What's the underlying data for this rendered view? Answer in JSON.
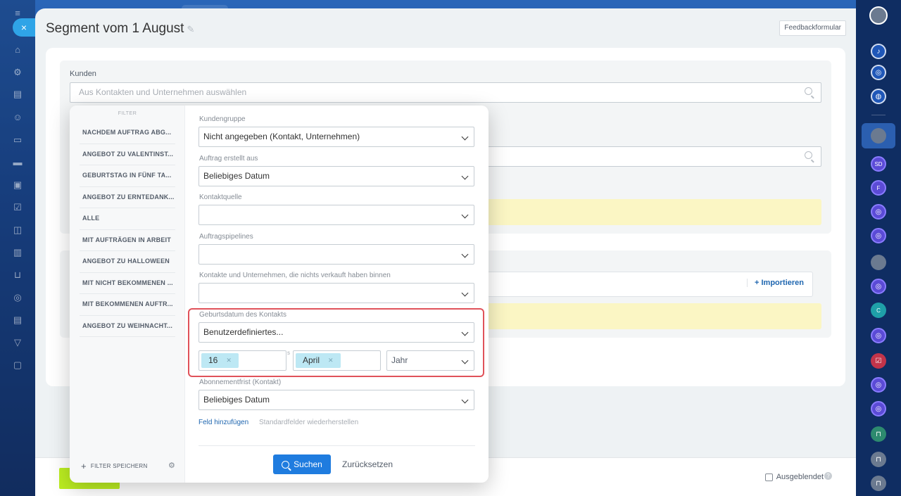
{
  "window": {
    "title": "Segment vom 1 August",
    "feedback_label": "Feedbackformular"
  },
  "main": {
    "customers_label": "Kunden",
    "customers_placeholder": "Aus Kontakten und Unternehmen auswählen",
    "import_label": "+ Importieren"
  },
  "filter": {
    "heading": "FILTER",
    "items": [
      "NACHDEM AUFTRAG ABG...",
      "ANGEBOT ZU VALENTINST...",
      "GEBURTSTAG IN FÜNF TA...",
      "ANGEBOT ZU ERNTEDANK...",
      "ALLE",
      "MIT AUFTRÄGEN IN ARBEIT",
      "ANGEBOT ZU HALLOWEEN",
      "MIT NICHT BEKOMMENEN ...",
      "MIT BEKOMMENEN AUFTR...",
      "ANGEBOT ZU WEIHNACHT..."
    ],
    "save_label": "FILTER SPEICHERN"
  },
  "fields": {
    "group_label": "Kundengruppe",
    "group_value": "Nicht angegeben (Kontakt, Unternehmen)",
    "order_label": "Auftrag erstellt aus",
    "order_value": "Beliebiges Datum",
    "source_label": "Kontaktquelle",
    "source_value": "",
    "pipelines_label": "Auftragspipelines",
    "pipelines_value": "",
    "nosale_label": "Kontakte und Unternehmen, die nichts verkauft haben binnen",
    "nosale_value": "",
    "birthday_label": "Geburtsdatum des Kontakts",
    "birthday_value": "Benutzerdefiniertes...",
    "day_tag": "16",
    "separator": "s",
    "month_tag": "April",
    "year_placeholder": "Jahr",
    "subscription_label": "Abonnementfrist (Kontakt)",
    "subscription_value": "Beliebiges Datum",
    "add_field": "Feld hinzufügen",
    "restore_fields": "Standardfelder wiederherstellen"
  },
  "actions": {
    "search": "Suchen",
    "reset": "Zurücksetzen"
  },
  "footer": {
    "hidden_label": "Ausgeblendet"
  },
  "colors": {
    "accent": "#1f7cdf",
    "highlight": "#e0525a",
    "tag": "#bde8f4",
    "save_green": "#bbed21"
  }
}
